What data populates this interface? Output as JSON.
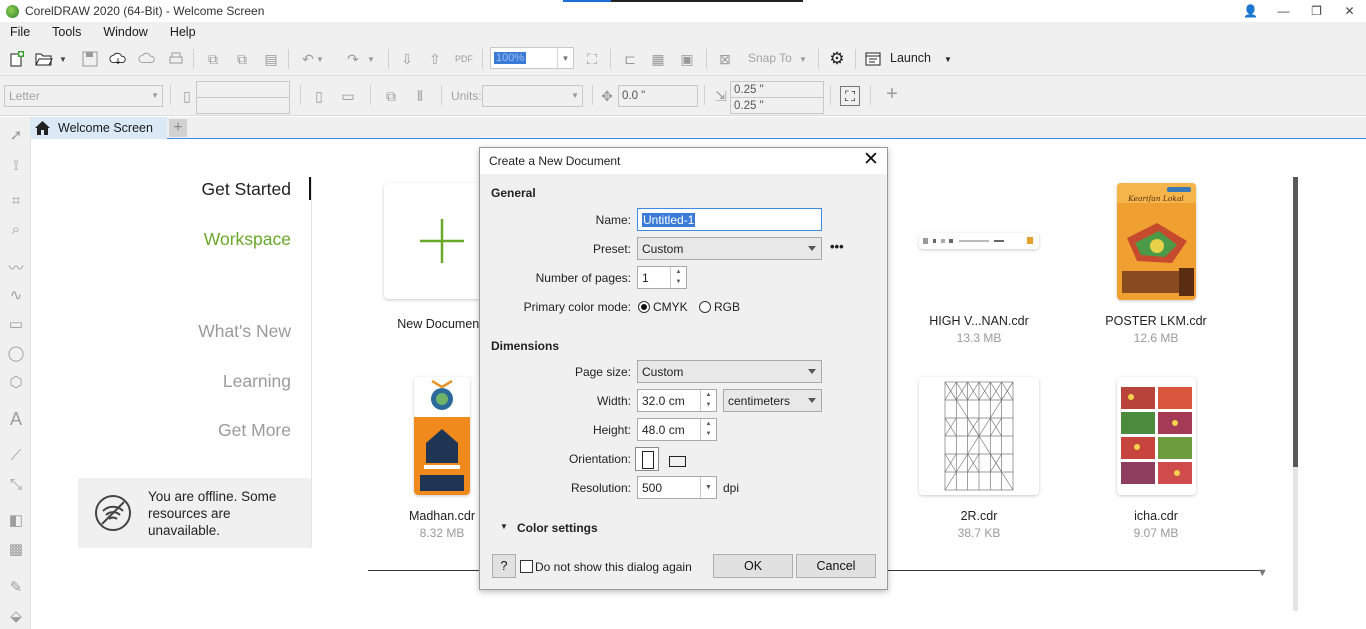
{
  "window": {
    "title": "CorelDRAW 2020 (64-Bit) - Welcome Screen",
    "controls": {
      "user": "👤",
      "minimize": "—",
      "restore": "❐",
      "close": "✕"
    }
  },
  "menu": {
    "items": [
      "File",
      "Tools",
      "Window",
      "Help"
    ]
  },
  "toolbar": {
    "zoom_value": "100%",
    "snap_to": "Snap To",
    "launch": "Launch"
  },
  "property_bar": {
    "page_size": "Letter",
    "units_label": "Units:",
    "nudge": "0.0 \"",
    "dup_x": "0.25 \"",
    "dup_y": "0.25 \""
  },
  "tabs": {
    "welcome": "Welcome Screen",
    "add": "+"
  },
  "welcome": {
    "nav": {
      "get_started": "Get Started",
      "workspace": "Workspace",
      "whats_new": "What's New",
      "learning": "Learning",
      "get_more": "Get More"
    },
    "offline_message": "You are offline. Some resources are unavailable.",
    "files": [
      {
        "name": "New Document",
        "size": ""
      },
      {
        "name": "HIGH V...NAN.cdr",
        "size": "13.3 MB"
      },
      {
        "name": "POSTER LKM.cdr",
        "size": "12.6 MB"
      },
      {
        "name": "Madhan.cdr",
        "size": "8.32 MB"
      },
      {
        "name": "2R.cdr",
        "size": "38.7 KB"
      },
      {
        "name": "icha.cdr",
        "size": "9.07 MB"
      }
    ],
    "poster_thumb_text": "Kearifan Lokal"
  },
  "dialog": {
    "title": "Create a New Document",
    "general_heading": "General",
    "name_label": "Name:",
    "name_value": "Untitled-1",
    "preset_label": "Preset:",
    "preset_value": "Custom",
    "pages_label": "Number of pages:",
    "pages_value": "1",
    "color_mode_label": "Primary color mode:",
    "color_mode_options": [
      "CMYK",
      "RGB"
    ],
    "color_mode_selected": "CMYK",
    "dimensions_heading": "Dimensions",
    "page_size_label": "Page size:",
    "page_size_value": "Custom",
    "width_label": "Width:",
    "width_value": "32.0 cm",
    "units_value": "centimeters",
    "height_label": "Height:",
    "height_value": "48.0 cm",
    "orientation_label": "Orientation:",
    "resolution_label": "Resolution:",
    "resolution_value": "500",
    "resolution_unit": "dpi",
    "color_settings": "Color settings",
    "help_button": "?",
    "dont_show_label": "Do not show this dialog again",
    "ok": "OK",
    "cancel": "Cancel",
    "more_icon": "•••"
  },
  "colors": {
    "accent_green": "#6aa829",
    "selection_blue": "#3b7bd8",
    "tab_active": "#dbe9f7"
  }
}
